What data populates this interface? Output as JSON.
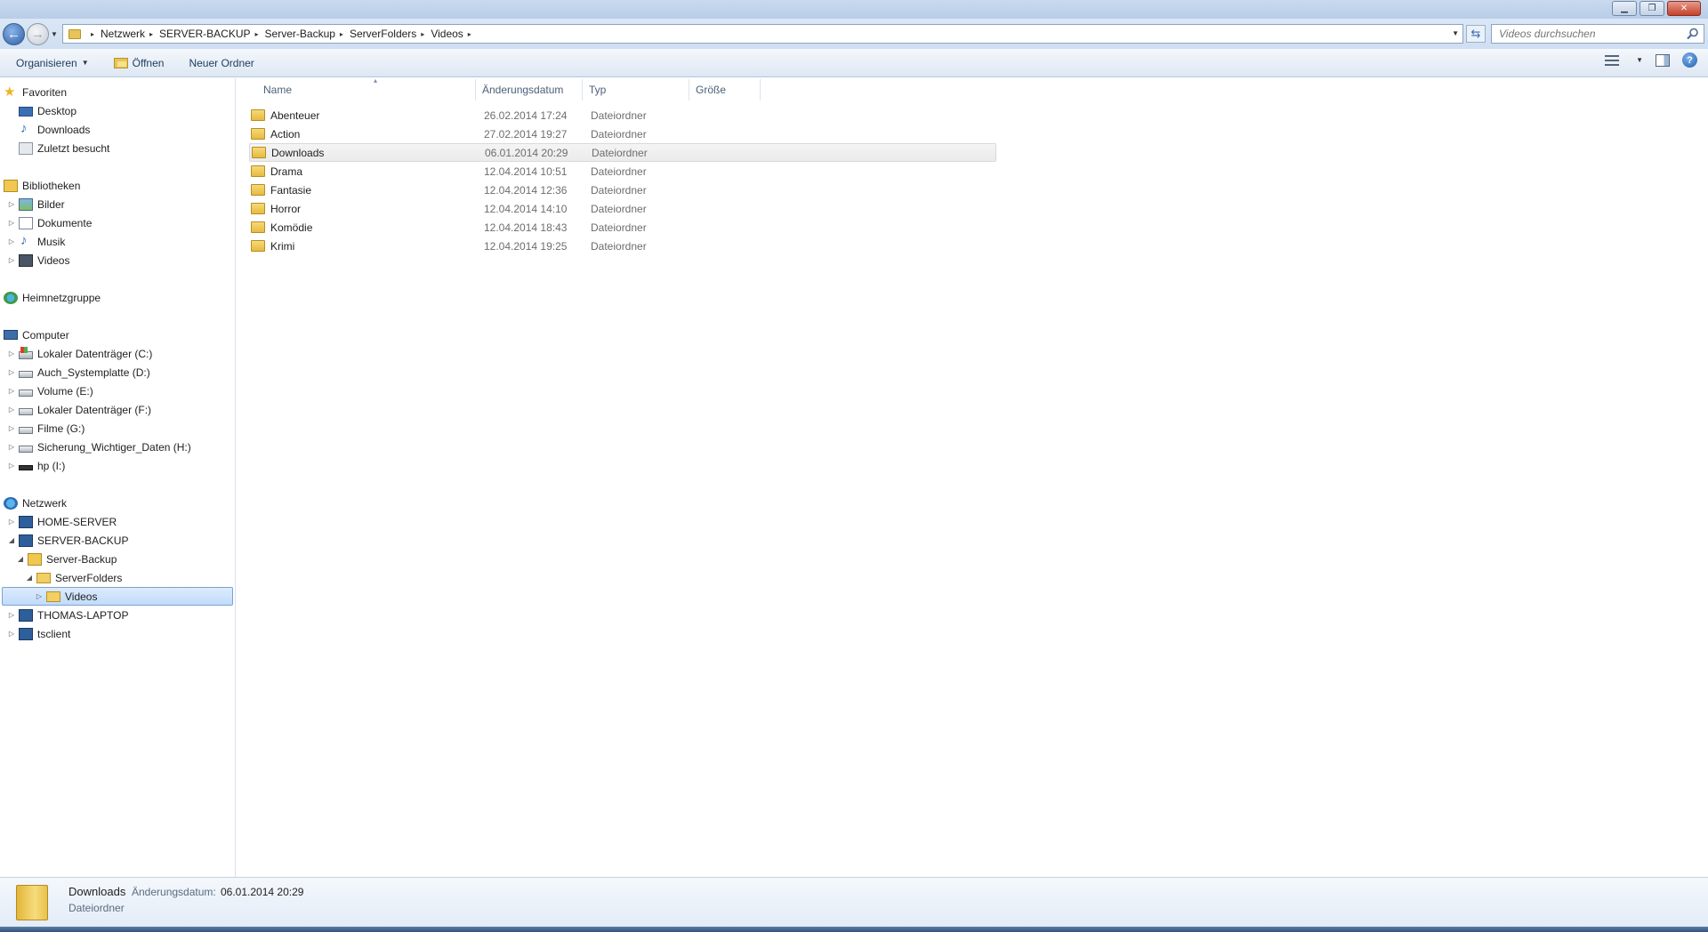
{
  "window": {
    "controls": {
      "minimize": "▁",
      "restore": "❐",
      "close": "✕"
    }
  },
  "address": {
    "breadcrumbs": [
      "Netzwerk",
      "SERVER-BACKUP",
      "Server-Backup",
      "ServerFolders",
      "Videos"
    ],
    "separator": "▸",
    "search_placeholder": "Videos durchsuchen"
  },
  "toolbar": {
    "organize_label": "Organisieren",
    "open_label": "Öffnen",
    "new_folder_label": "Neuer Ordner"
  },
  "nav_pane": {
    "items": [
      {
        "label": "Favoriten",
        "icon": "star-icon",
        "expander": "◢"
      },
      {
        "label": "Desktop",
        "icon": "desktop-icon",
        "expander": ""
      },
      {
        "label": "Downloads",
        "icon": "music-note-icon",
        "expander": ""
      },
      {
        "label": "Zuletzt besucht",
        "icon": "recent-places-icon",
        "expander": ""
      },
      {
        "label": "Bibliotheken",
        "icon": "library-icon",
        "expander": "◢"
      },
      {
        "label": "Bilder",
        "icon": "pictures-icon",
        "expander": "▷"
      },
      {
        "label": "Dokumente",
        "icon": "document-icon",
        "expander": "▷"
      },
      {
        "label": "Musik",
        "icon": "music-icon",
        "expander": "▷"
      },
      {
        "label": "Videos",
        "icon": "video-icon",
        "expander": "▷"
      },
      {
        "label": "Heimnetzgruppe",
        "icon": "homegroup-icon",
        "expander": "▷"
      },
      {
        "label": "Computer",
        "icon": "computer-icon",
        "expander": "◢"
      },
      {
        "label": "Lokaler Datenträger (C:)",
        "icon": "system-drive-icon",
        "expander": "▷"
      },
      {
        "label": "Auch_Systemplatte (D:)",
        "icon": "drive-icon",
        "expander": "▷"
      },
      {
        "label": "Volume (E:)",
        "icon": "drive-icon",
        "expander": "▷"
      },
      {
        "label": "Lokaler Datenträger (F:)",
        "icon": "drive-icon",
        "expander": "▷"
      },
      {
        "label": "Filme (G:)",
        "icon": "drive-icon",
        "expander": "▷"
      },
      {
        "label": "Sicherung_Wichtiger_Daten (H:)",
        "icon": "drive-icon",
        "expander": "▷"
      },
      {
        "label": "hp (I:)",
        "icon": "usb-drive-icon",
        "expander": "▷"
      },
      {
        "label": "Netzwerk",
        "icon": "network-icon",
        "expander": "◢"
      },
      {
        "label": "HOME-SERVER",
        "icon": "network-computer-icon",
        "expander": "▷"
      },
      {
        "label": "SERVER-BACKUP",
        "icon": "network-computer-icon",
        "expander": "◢"
      },
      {
        "label": "Server-Backup",
        "icon": "shared-folder-icon",
        "expander": "◢"
      },
      {
        "label": "ServerFolders",
        "icon": "folder-icon",
        "expander": "◢"
      },
      {
        "label": "Videos",
        "icon": "folder-icon",
        "expander": "▷"
      },
      {
        "label": "THOMAS-LAPTOP",
        "icon": "network-computer-icon",
        "expander": "▷"
      },
      {
        "label": "tsclient",
        "icon": "network-computer-icon",
        "expander": "▷"
      }
    ]
  },
  "file_list": {
    "columns": [
      "Name",
      "Änderungsdatum",
      "Typ",
      "Größe"
    ],
    "sort_indicator": "▴",
    "rows": [
      {
        "name": "Abenteuer",
        "date": "26.02.2014 17:24",
        "type": "Dateiordner",
        "size": ""
      },
      {
        "name": "Action",
        "date": "27.02.2014 19:27",
        "type": "Dateiordner",
        "size": ""
      },
      {
        "name": "Downloads",
        "date": "06.01.2014 20:29",
        "type": "Dateiordner",
        "size": ""
      },
      {
        "name": "Drama",
        "date": "12.04.2014 10:51",
        "type": "Dateiordner",
        "size": ""
      },
      {
        "name": "Fantasie",
        "date": "12.04.2014 12:36",
        "type": "Dateiordner",
        "size": ""
      },
      {
        "name": "Horror",
        "date": "12.04.2014 14:10",
        "type": "Dateiordner",
        "size": ""
      },
      {
        "name": "Komödie",
        "date": "12.04.2014 18:43",
        "type": "Dateiordner",
        "size": ""
      },
      {
        "name": "Krimi",
        "date": "12.04.2014 19:25",
        "type": "Dateiordner",
        "size": ""
      }
    ]
  },
  "details": {
    "name": "Downloads",
    "date_label": "Änderungsdatum:",
    "date": "06.01.2014 20:29",
    "type": "Dateiordner"
  },
  "colors": {
    "selection_bg": "#c1dbfc",
    "selection_border": "#7da2ce",
    "chrome_blue": "#cfdff1"
  }
}
